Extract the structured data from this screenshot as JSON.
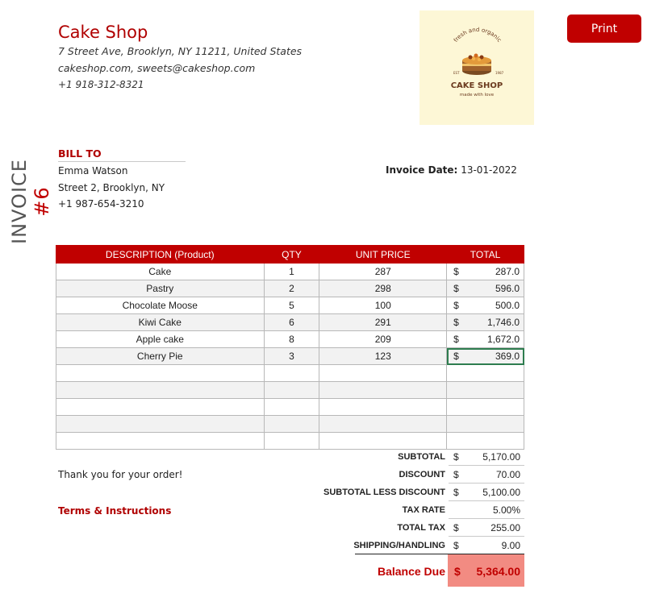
{
  "shop": {
    "name": "Cake Shop",
    "address": "7 Street Ave, Brooklyn, NY 11211, United States",
    "web_email": "cakeshop.com, sweets@cakeshop.com",
    "phone": "+1 918-312-8321"
  },
  "logo": {
    "arc_text": "fresh and organic",
    "since_left": "EST",
    "since_right": "1987",
    "title": "CAKE SHOP",
    "tagline": "made with love"
  },
  "print_label": "Print",
  "invoice": {
    "word": "INVOICE",
    "number": "#6",
    "date_label": "Invoice Date:",
    "date": "13-01-2022"
  },
  "bill_to": {
    "heading": "BILL TO",
    "name": "Emma Watson",
    "street": "Street 2, Brooklyn, NY",
    "phone": "+1 987-654-3210"
  },
  "table": {
    "headers": [
      "DESCRIPTION (Product)",
      "QTY",
      "UNIT PRICE",
      "TOTAL"
    ],
    "currency": "$",
    "rows": [
      {
        "desc": "Cake",
        "qty": "1",
        "price": "287",
        "total": "287.0"
      },
      {
        "desc": "Pastry",
        "qty": "2",
        "price": "298",
        "total": "596.0"
      },
      {
        "desc": "Chocolate Moose",
        "qty": "5",
        "price": "100",
        "total": "500.0"
      },
      {
        "desc": "Kiwi Cake",
        "qty": "6",
        "price": "291",
        "total": "1,746.0"
      },
      {
        "desc": "Apple cake",
        "qty": "8",
        "price": "209",
        "total": "1,672.0"
      },
      {
        "desc": "Cherry Pie",
        "qty": "3",
        "price": "123",
        "total": "369.0"
      }
    ]
  },
  "summary": {
    "subtotal_label": "SUBTOTAL",
    "subtotal": "5,170.00",
    "discount_label": "DISCOUNT",
    "discount": "70.00",
    "sld_label": "SUBTOTAL LESS DISCOUNT",
    "sld": "5,100.00",
    "taxrate_label": "TAX RATE",
    "taxrate": "5.00%",
    "totaltax_label": "TOTAL TAX",
    "totaltax": "255.00",
    "shipping_label": "SHIPPING/HANDLING",
    "shipping": "9.00",
    "balance_label": "Balance Due",
    "balance": "5,364.00"
  },
  "thanks": "Thank you for your order!",
  "terms": "Terms & Instructions",
  "colors": {
    "brand_red": "#c00000",
    "balance_bg": "#f28b82",
    "logo_bg": "#fdf7d6"
  }
}
